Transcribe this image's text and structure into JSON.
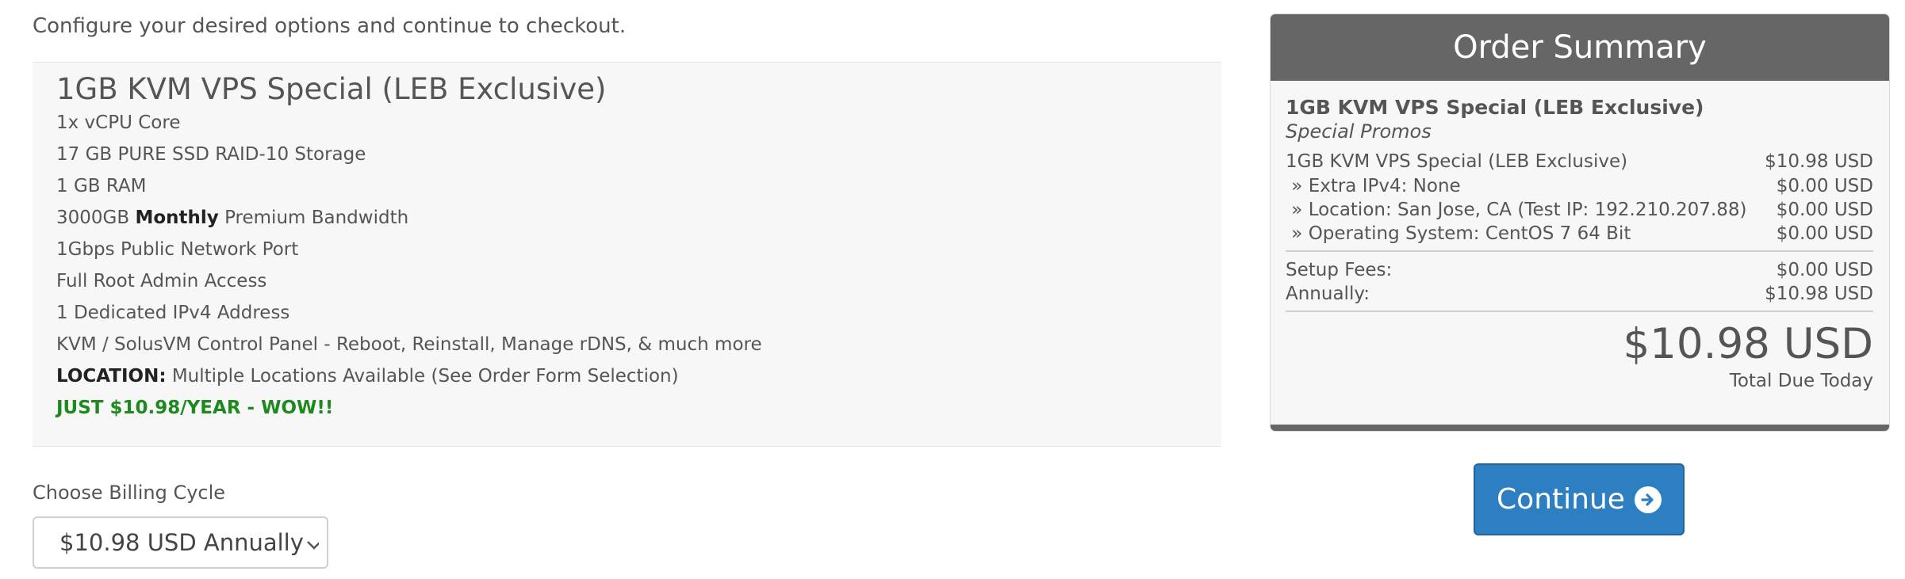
{
  "intro": "Configure your desired options and continue to checkout.",
  "product": {
    "title": "1GB KVM VPS Special (LEB Exclusive)",
    "features": [
      {
        "text": "1x vCPU Core"
      },
      {
        "text": "17 GB PURE SSD RAID-10 Storage"
      },
      {
        "text": "1 GB RAM"
      },
      {
        "pre": "3000GB ",
        "bold": "Monthly",
        "post": " Premium Bandwidth"
      },
      {
        "text": "1Gbps Public Network Port"
      },
      {
        "text": "Full Root Admin Access"
      },
      {
        "text": "1 Dedicated IPv4 Address"
      },
      {
        "text": "KVM / SolusVM Control Panel - Reboot, Reinstall, Manage rDNS, & much more"
      },
      {
        "bold": "LOCATION:",
        "post": " Multiple Locations Available (See Order Form Selection)"
      },
      {
        "promo": "JUST $10.98/YEAR - WOW!!"
      }
    ]
  },
  "billing": {
    "label": "Choose Billing Cycle",
    "selected": "$10.98 USD Annually"
  },
  "summary": {
    "header": "Order Summary",
    "product_name": "1GB KVM VPS Special (LEB Exclusive)",
    "group": "Special Promos",
    "lines": [
      {
        "label": "1GB KVM VPS Special (LEB Exclusive)",
        "amount": "$10.98 USD"
      },
      {
        "label": " » Extra IPv4: None",
        "amount": "$0.00 USD"
      },
      {
        "label": " » Location: San Jose, CA (Test IP: 192.210.207.88)",
        "amount": "$0.00 USD"
      },
      {
        "label": " » Operating System: CentOS 7 64 Bit",
        "amount": "$0.00 USD"
      }
    ],
    "fees": [
      {
        "label": "Setup Fees:",
        "amount": "$0.00 USD"
      },
      {
        "label": "Annually:",
        "amount": "$10.98 USD"
      }
    ],
    "total": "$10.98 USD",
    "total_label": "Total Due Today"
  },
  "continue_label": "Continue",
  "icons": {
    "continue": "arrow-circle-right-icon",
    "select": "chevron-down-icon"
  },
  "colors": {
    "primary": "#2d7fc1",
    "promo": "#1e8a1e",
    "summary_header": "#666666"
  }
}
